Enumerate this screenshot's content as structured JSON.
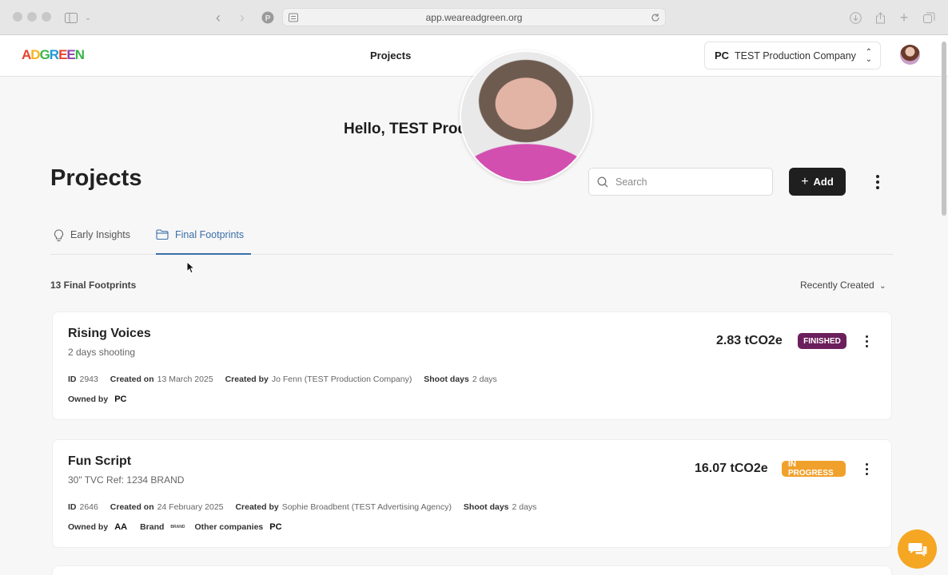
{
  "browser": {
    "url": "app.weareadgreen.org"
  },
  "header": {
    "logo": "ADGREEN",
    "nav_item": "Projects",
    "company_initials": "PC",
    "company_name": "TEST Production Company"
  },
  "main": {
    "greeting": "Hello, TEST Production Company",
    "title": "Projects",
    "search_placeholder": "Search",
    "add_label": "Add",
    "tabs": [
      {
        "label": "Early Insights",
        "icon": "lightbulb-icon",
        "active": false
      },
      {
        "label": "Final Footprints",
        "icon": "folder-icon",
        "active": true
      }
    ],
    "count_label": "13 Final Footprints",
    "sort_label": "Recently Created"
  },
  "labels": {
    "id": "ID",
    "created_on": "Created on",
    "created_by": "Created by",
    "shoot_days": "Shoot days",
    "owned_by": "Owned by",
    "brand": "Brand",
    "other_companies": "Other companies"
  },
  "projects": [
    {
      "title": "Rising Voices",
      "subtitle": "2 days shooting",
      "co2": "2.83 tCO2e",
      "status": "FINISHED",
      "status_color": "#6b1f5c",
      "id": "2943",
      "created_on": "13 March 2025",
      "created_by": "Jo Fenn (TEST Production Company)",
      "shoot_days": "2 days",
      "owned_by": "PC"
    },
    {
      "title": "Fun Script",
      "subtitle": "30\" TVC Ref: 1234 BRAND",
      "co2": "16.07 tCO2e",
      "status": "IN PROGRESS",
      "status_color": "#f0a12b",
      "id": "2646",
      "created_on": "24 February 2025",
      "created_by": "Sophie Broadbent (TEST Advertising Agency)",
      "shoot_days": "2 days",
      "owned_by": "AA",
      "brand": "BRAND",
      "other_companies": "PC"
    }
  ]
}
